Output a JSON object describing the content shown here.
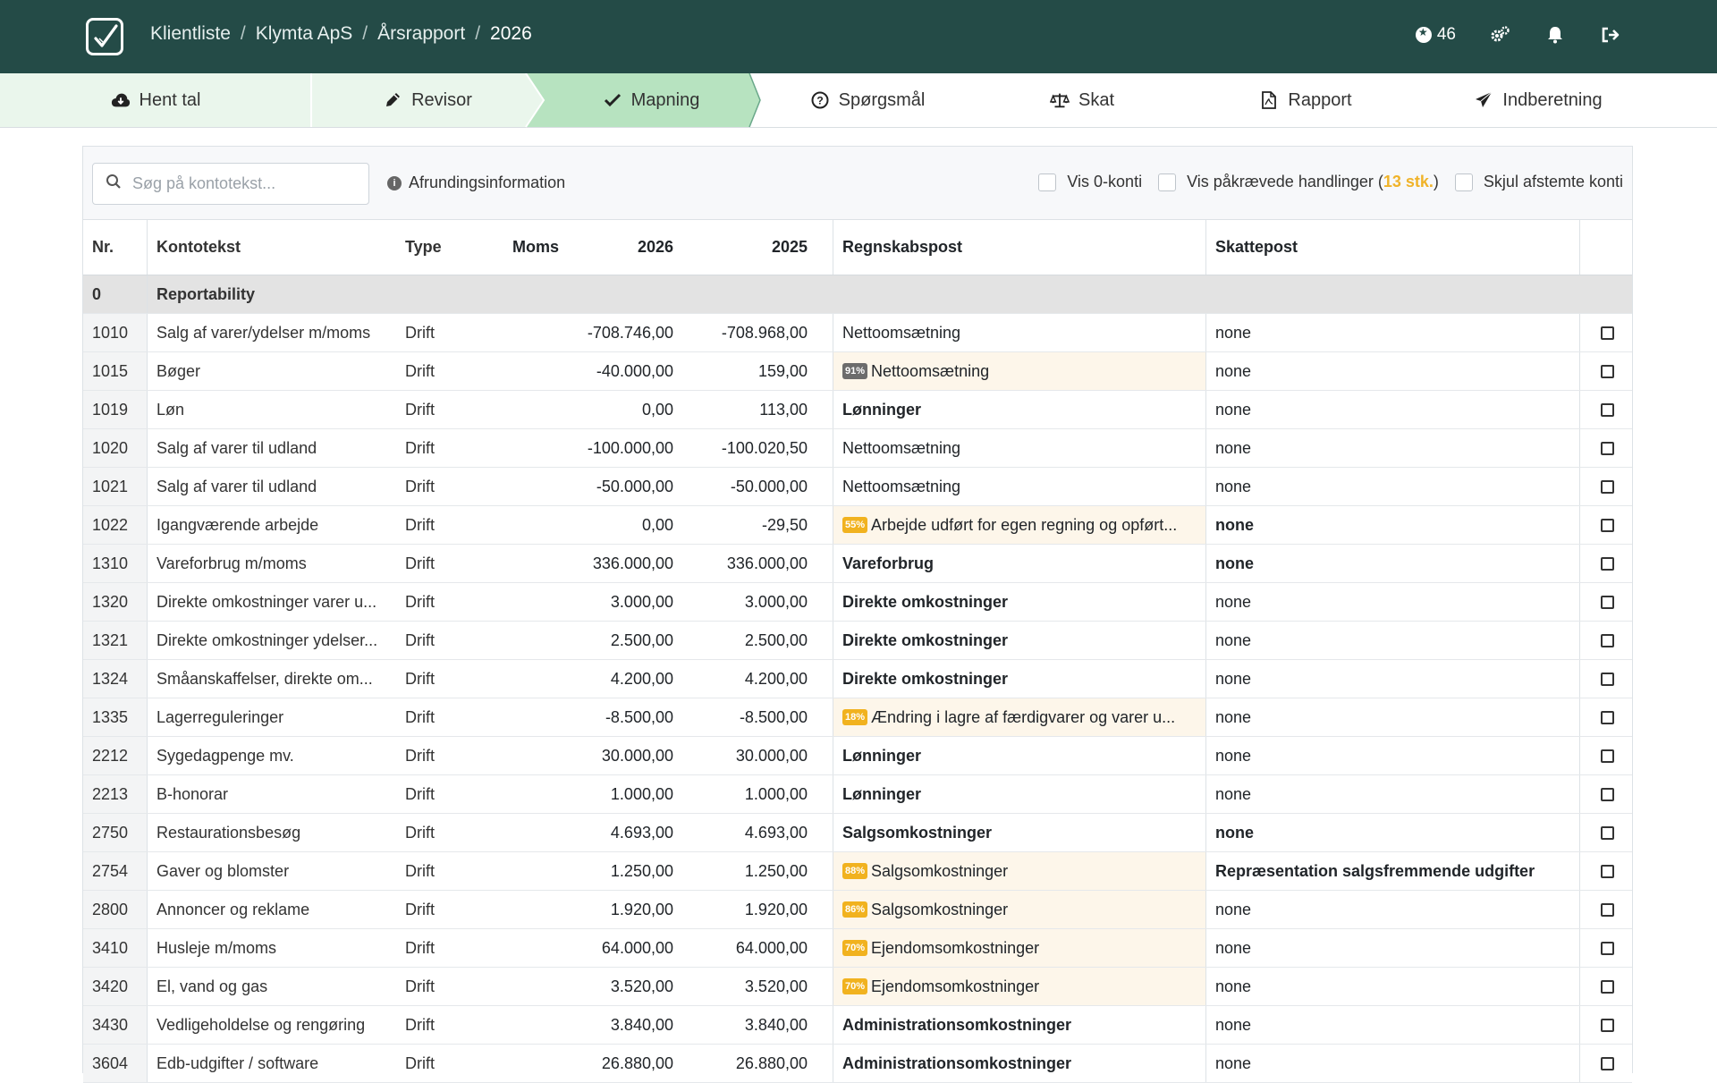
{
  "breadcrumb": [
    "Klientliste",
    "Klymta ApS",
    "Årsrapport",
    "2026"
  ],
  "coins": "46",
  "steps": [
    {
      "label": "Hent tal",
      "icon": "cloud-download-icon"
    },
    {
      "label": "Revisor",
      "icon": "pencil-icon"
    },
    {
      "label": "Mapning",
      "icon": "check-icon"
    },
    {
      "label": "Spørgsmål",
      "icon": "question-circle-icon"
    },
    {
      "label": "Skat",
      "icon": "balance-scale-icon"
    },
    {
      "label": "Rapport",
      "icon": "pdf-file-icon"
    },
    {
      "label": "Indberetning",
      "icon": "paper-plane-icon"
    }
  ],
  "toolbar": {
    "search_placeholder": "Søg på kontotekst...",
    "info_label": "Afrundingsinformation",
    "chk_zero": "Vis 0-konti",
    "chk_required_pre": "Vis påkrævede handlinger (",
    "chk_required_count": "13 stk.",
    "chk_required_post": ")",
    "chk_hide": "Skjul afstemte konti"
  },
  "columns": {
    "nr": "Nr.",
    "text": "Kontotekst",
    "type": "Type",
    "moms": "Moms",
    "y1": "2026",
    "y2": "2025",
    "regn": "Regnskabspost",
    "skat": "Skattepost"
  },
  "group": {
    "nr": "0",
    "label": "Reportability"
  },
  "rows": [
    {
      "nr": "1010",
      "text": "Salg af varer/ydelser m/moms",
      "type": "Drift",
      "v1": "-708.746,00",
      "v2": "-708.968,00",
      "regn": "Nettoomsætning",
      "skat": "none"
    },
    {
      "nr": "1015",
      "text": "Bøger",
      "type": "Drift",
      "v1": "-40.000,00",
      "v2": "159,00",
      "badge": "91%",
      "regn": "Nettoomsætning",
      "skat": "none"
    },
    {
      "nr": "1019",
      "text": "Løn",
      "type": "Drift",
      "v1": "0,00",
      "v2": "113,00",
      "regn": "Lønninger",
      "skat": "none"
    },
    {
      "nr": "1020",
      "text": "Salg af varer til udland",
      "type": "Drift",
      "v1": "-100.000,00",
      "v2": "-100.020,50",
      "regn": "Nettoomsætning",
      "skat": "none"
    },
    {
      "nr": "1021",
      "text": "Salg af varer til udland",
      "type": "Drift",
      "v1": "-50.000,00",
      "v2": "-50.000,00",
      "regn": "Nettoomsætning",
      "skat": "none"
    },
    {
      "nr": "1022",
      "text": "Igangværende arbejde",
      "type": "Drift",
      "v1": "0,00",
      "v2": "-29,50",
      "badge": "55%",
      "regn": "Arbejde udført for egen regning og opført...",
      "skat": "none"
    },
    {
      "nr": "1310",
      "text": "Vareforbrug m/moms",
      "type": "Drift",
      "v1": "336.000,00",
      "v2": "336.000,00",
      "regn": "Vareforbrug",
      "skat": "none"
    },
    {
      "nr": "1320",
      "text": "Direkte omkostninger varer u...",
      "type": "Drift",
      "v1": "3.000,00",
      "v2": "3.000,00",
      "regn": "Direkte omkostninger",
      "skat": "none"
    },
    {
      "nr": "1321",
      "text": "Direkte omkostninger ydelser...",
      "type": "Drift",
      "v1": "2.500,00",
      "v2": "2.500,00",
      "regn": "Direkte omkostninger",
      "skat": "none"
    },
    {
      "nr": "1324",
      "text": "Småanskaffelser, direkte om...",
      "type": "Drift",
      "v1": "4.200,00",
      "v2": "4.200,00",
      "regn": "Direkte omkostninger",
      "skat": "none"
    },
    {
      "nr": "1335",
      "text": "Lagerreguleringer",
      "type": "Drift",
      "v1": "-8.500,00",
      "v2": "-8.500,00",
      "badge": "18%",
      "regn": "Ændring i lagre af færdigvarer og varer u...",
      "skat": "none"
    },
    {
      "nr": "2212",
      "text": "Sygedagpenge mv.",
      "type": "Drift",
      "v1": "30.000,00",
      "v2": "30.000,00",
      "regn": "Lønninger",
      "skat": "none"
    },
    {
      "nr": "2213",
      "text": "B-honorar",
      "type": "Drift",
      "v1": "1.000,00",
      "v2": "1.000,00",
      "regn": "Lønninger",
      "skat": "none"
    },
    {
      "nr": "2750",
      "text": "Restaurationsbesøg",
      "type": "Drift",
      "v1": "4.693,00",
      "v2": "4.693,00",
      "regn": "Salgsomkostninger",
      "skat": "none"
    },
    {
      "nr": "2754",
      "text": "Gaver og blomster",
      "type": "Drift",
      "v1": "1.250,00",
      "v2": "1.250,00",
      "badge": "88%",
      "regn": "Salgsomkostninger",
      "skat": "Repræsentation salgsfremmende udgifter"
    },
    {
      "nr": "2800",
      "text": "Annoncer og reklame",
      "type": "Drift",
      "v1": "1.920,00",
      "v2": "1.920,00",
      "badge": "86%",
      "regn": "Salgsomkostninger",
      "skat": "none"
    },
    {
      "nr": "3410",
      "text": "Husleje m/moms",
      "type": "Drift",
      "v1": "64.000,00",
      "v2": "64.000,00",
      "badge": "70%",
      "regn": "Ejendomsomkostninger",
      "skat": "none"
    },
    {
      "nr": "3420",
      "text": "El, vand og gas",
      "type": "Drift",
      "v1": "3.520,00",
      "v2": "3.520,00",
      "badge": "70%",
      "regn": "Ejendomsomkostninger",
      "skat": "none"
    },
    {
      "nr": "3430",
      "text": "Vedligeholdelse og rengøring",
      "type": "Drift",
      "v1": "3.840,00",
      "v2": "3.840,00",
      "regn": "Administrationsomkostninger",
      "skat": "none"
    },
    {
      "nr": "3604",
      "text": "Edb-udgifter / software",
      "type": "Drift",
      "v1": "26.880,00",
      "v2": "26.880,00",
      "regn": "Administrationsomkostninger",
      "skat": "none"
    }
  ],
  "colors": {
    "topbar": "#244b47",
    "step_current": "#b7e3c0",
    "step_done": "#eaf6ec",
    "badge_yellow": "#f1b21f",
    "badge_gray": "#6c6c6c",
    "suggest_bg": "#fdf6ea"
  }
}
